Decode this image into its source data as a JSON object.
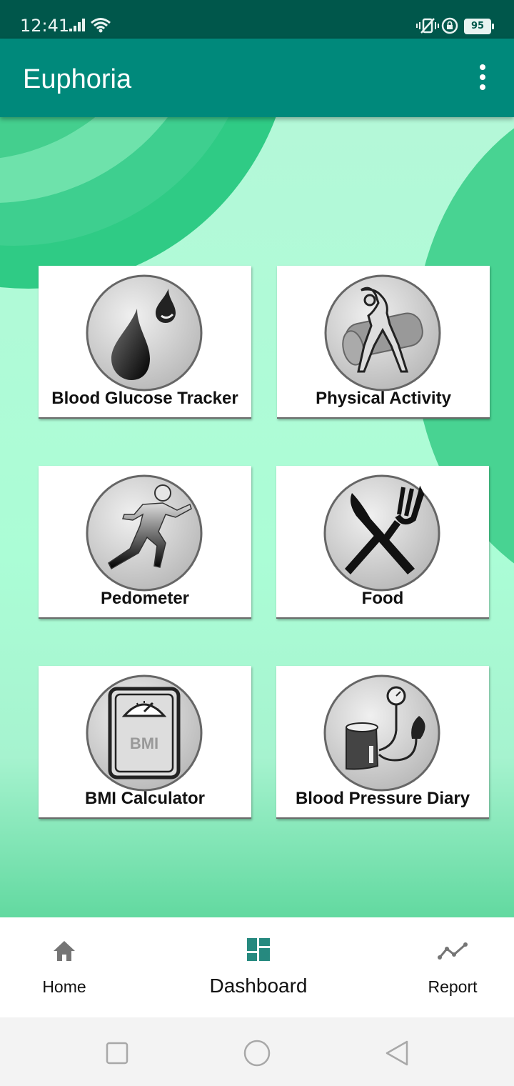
{
  "status_bar": {
    "time": "12:41",
    "battery": "95"
  },
  "app_bar": {
    "title": "Euphoria"
  },
  "tiles": [
    {
      "label": "Blood Glucose Tracker",
      "icon": "blood-drop-icon"
    },
    {
      "label": "Physical Activity",
      "icon": "exercise-icon"
    },
    {
      "label": "Pedometer",
      "icon": "runner-icon"
    },
    {
      "label": "Food",
      "icon": "knife-fork-icon"
    },
    {
      "label": "BMI Calculator",
      "icon": "bmi-scale-icon"
    },
    {
      "label": "Blood Pressure Diary",
      "icon": "blood-pressure-monitor-icon"
    }
  ],
  "bmi_icon_text": "BMI",
  "bottom_nav": {
    "items": [
      {
        "label": "Home",
        "icon": "home-icon"
      },
      {
        "label": "Dashboard",
        "icon": "dashboard-icon",
        "active": true
      },
      {
        "label": "Report",
        "icon": "trend-line-icon"
      }
    ]
  },
  "colors": {
    "status_bar": "#00574b",
    "app_bar": "#00897b",
    "background": "#abfdd6",
    "accent_circle": "#4bd495",
    "dashboard_icon": "#26897f"
  }
}
